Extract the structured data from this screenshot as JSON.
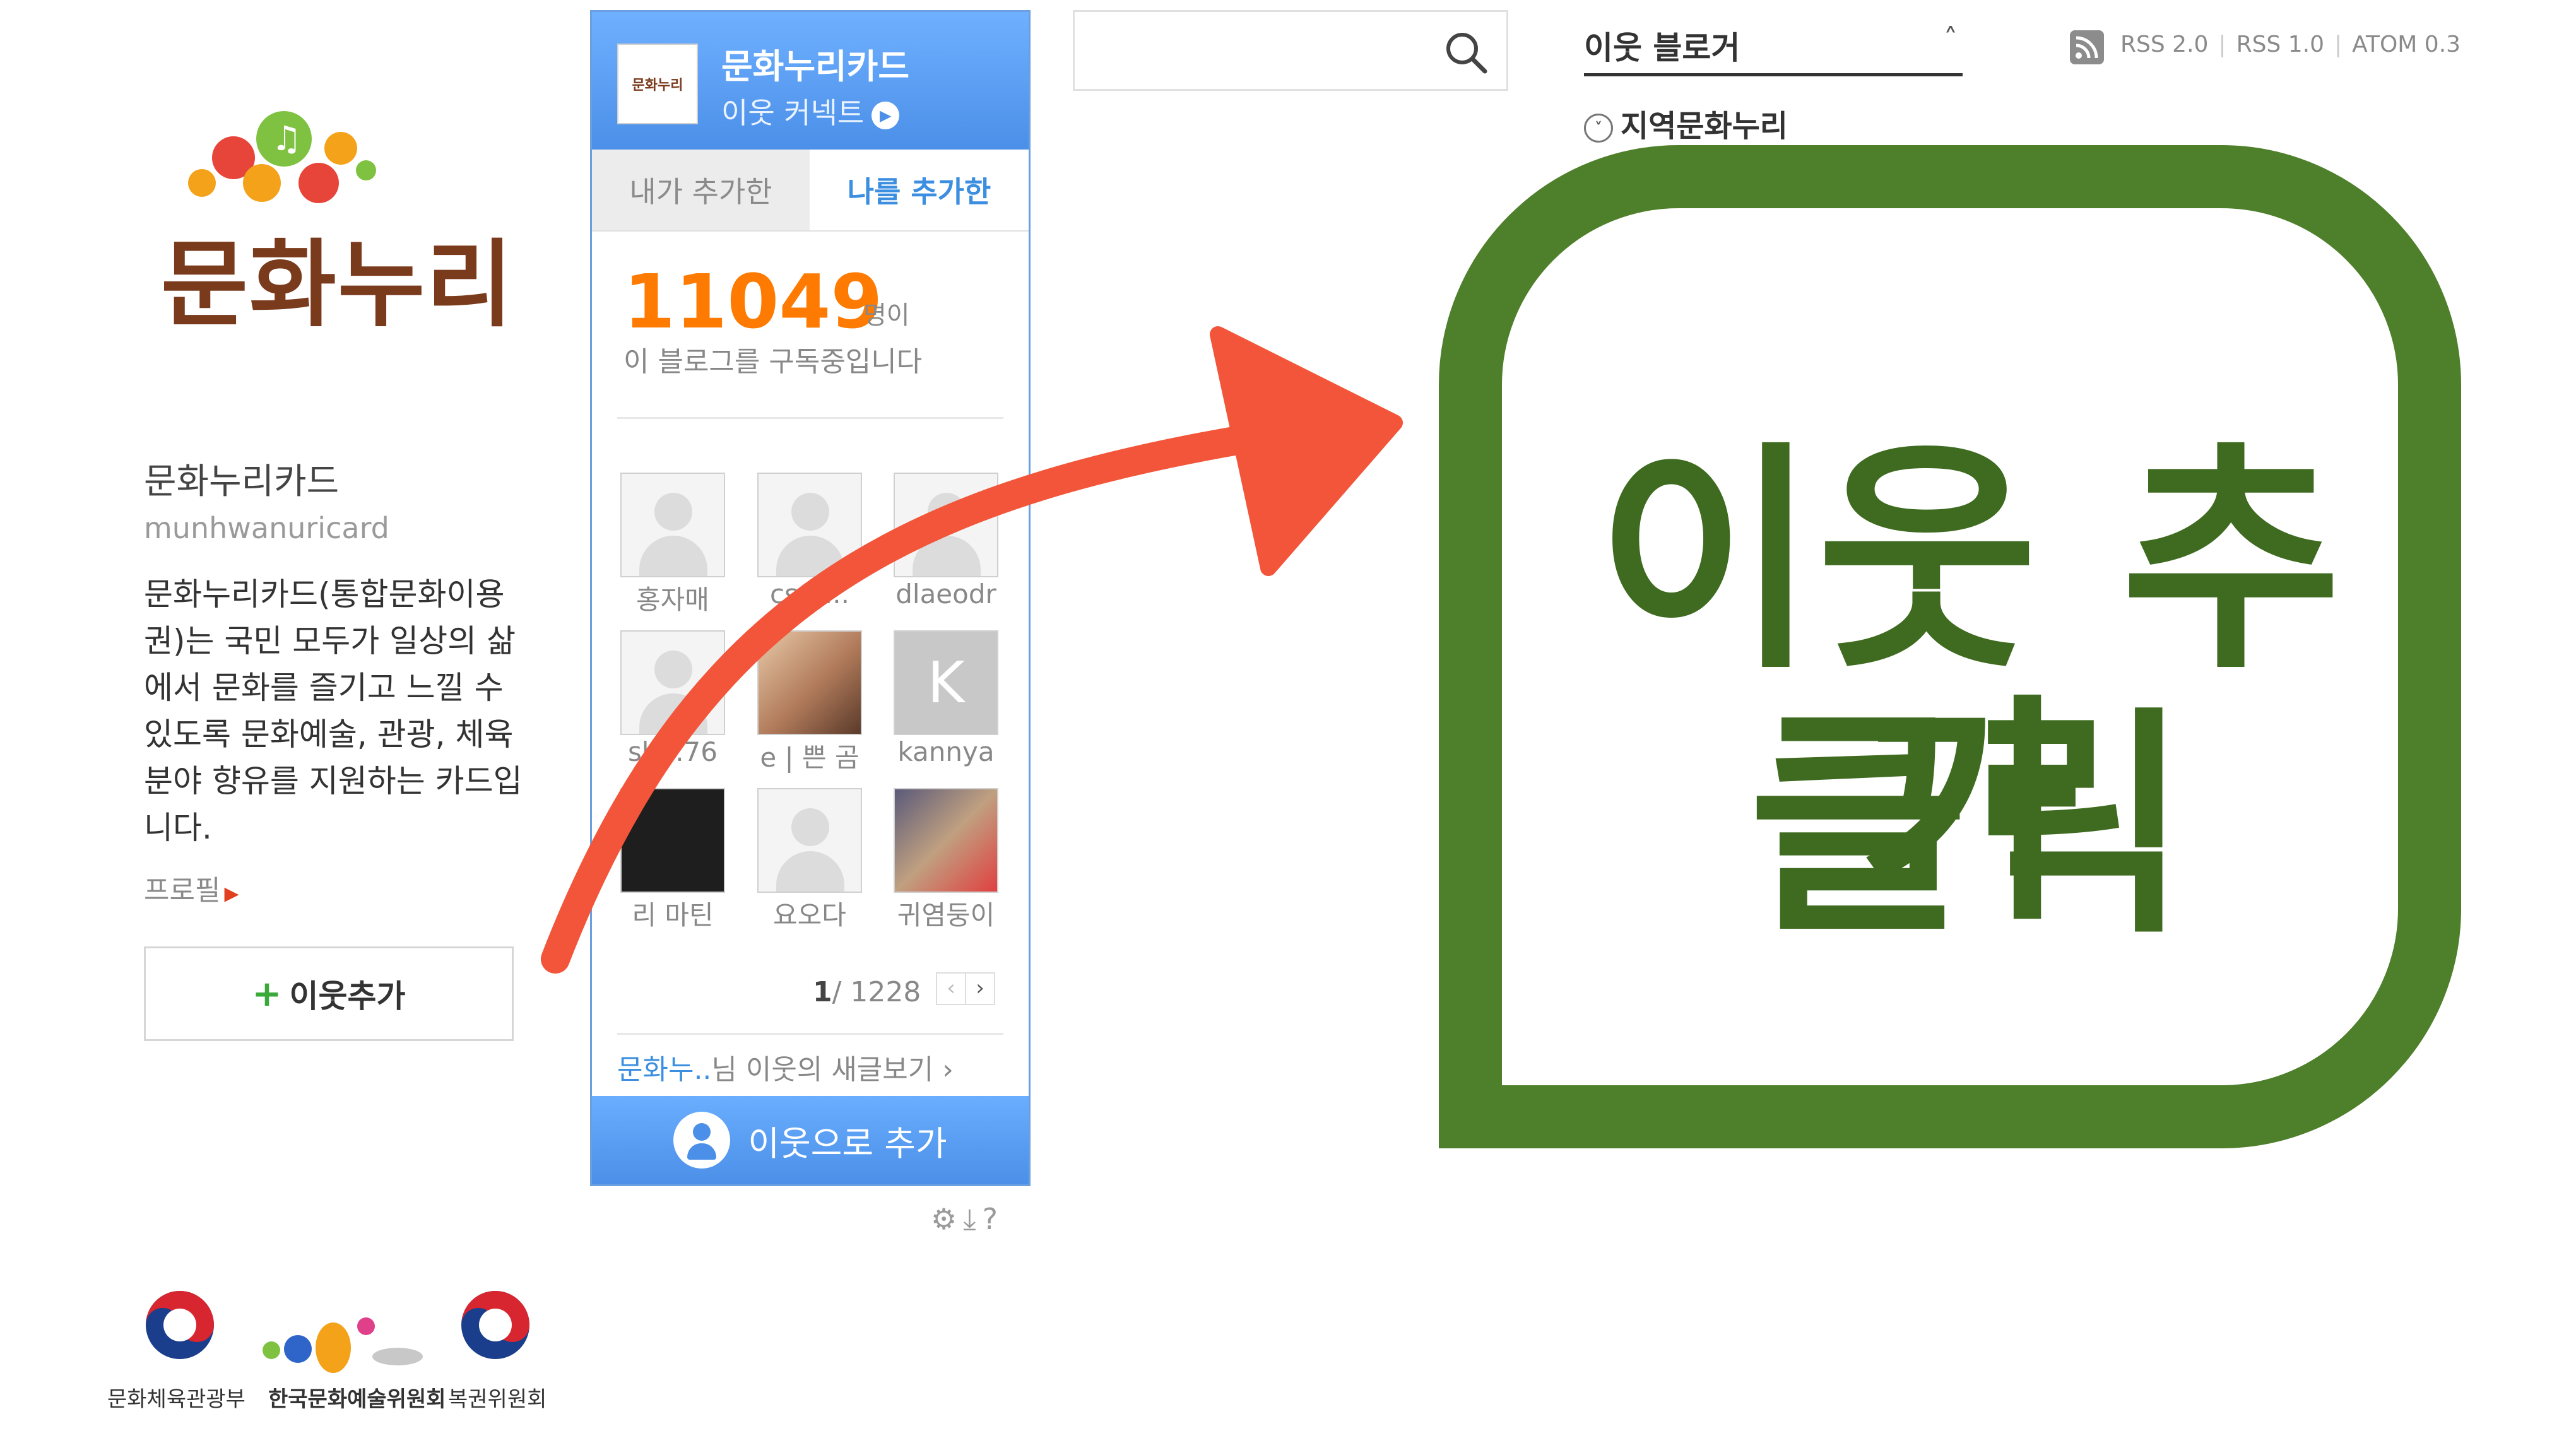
{
  "profile": {
    "logo_text": "문화누리",
    "name": "문화누리카드",
    "blog_id": "munhwanuricard",
    "description": "문화누리카드(통합문화이용권)는 국민 모두가 일상의 삶에서 문화를 즐기고 느낄 수 있도록 문화예술, 관광, 체육 분야 향유를 지원하는 카드입니다.",
    "profile_link": "프로필",
    "add_neighbor_label": "이웃추가"
  },
  "widget": {
    "title": "문화누리카드",
    "subtitle": "이웃 커넥트",
    "thumb_text": "문화누리",
    "tabs": [
      "내가 추가한",
      "나를 추가한"
    ],
    "subscriber_count": "11049",
    "subscriber_unit": "명이",
    "subscriber_text": "이 블로그를 구독중입니다",
    "neighbors": [
      {
        "name": "홍자매",
        "avatar": "default"
      },
      {
        "name": "csm...",
        "avatar": "default"
      },
      {
        "name": "dlaeodr",
        "avatar": "default"
      },
      {
        "name": "sh...76",
        "avatar": "default"
      },
      {
        "name": "e | 쁜 곰",
        "avatar": "photo"
      },
      {
        "name": "kannya",
        "avatar": "letter"
      },
      {
        "name": "리 마틴",
        "avatar": "dark"
      },
      {
        "name": "요오다",
        "avatar": "default"
      },
      {
        "name": "귀염둥이",
        "avatar": "photo"
      }
    ],
    "letter_avatar": "K",
    "pager_current": "1",
    "pager_total": "/ 1228",
    "new_posts_highlight": "문화누..",
    "new_posts_text": "님 이웃의 새글보기",
    "cta_label": "이웃으로 추가",
    "tools": [
      "gear-icon",
      "download-icon",
      "help-icon"
    ]
  },
  "search": {
    "placeholder": ""
  },
  "neighbor_blogger": {
    "label": "이웃 블로거",
    "item": "지역문화누리"
  },
  "feeds": [
    "RSS 2.0",
    "RSS 1.0",
    "ATOM 0.3"
  ],
  "callout": {
    "line1": "이웃 추가",
    "line2": "클릭"
  },
  "footer": {
    "labels": [
      "문화체육관광부",
      "한국문화예술위원회",
      "복권위원회"
    ]
  },
  "colors": {
    "callout_green": "#4e7f2a",
    "arrow_red": "#f2553a",
    "widget_blue": "#4b8fe8",
    "count_orange": "#ff7a00"
  }
}
